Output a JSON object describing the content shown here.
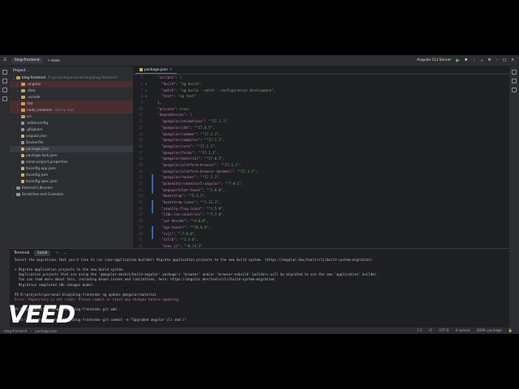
{
  "titlebar": {
    "project_chip": "blog-frontend",
    "branch": "main",
    "run_config": "Angular CLI Server"
  },
  "project_panel": {
    "title": "Project",
    "root": {
      "name": "blog-frontend",
      "path": "D:\\projects\\personal-blog\\blog-frontend"
    },
    "items": [
      {
        "label": ".angular",
        "type": "folder",
        "excluded": true,
        "expandable": true
      },
      {
        "label": ".idea",
        "type": "folder",
        "excluded": false,
        "expandable": true
      },
      {
        "label": ".vscode",
        "type": "folder",
        "excluded": false,
        "expandable": true
      },
      {
        "label": "dist",
        "type": "folder",
        "excluded": true,
        "expandable": true
      },
      {
        "label": "node_modules",
        "type": "folder",
        "excluded": true,
        "expandable": true,
        "sub": "library root"
      },
      {
        "label": "src",
        "type": "folder",
        "excluded": false,
        "expandable": true
      },
      {
        "label": ".editorconfig",
        "type": "doc",
        "excluded": false,
        "expandable": false
      },
      {
        "label": ".gitignore",
        "type": "doc",
        "excluded": false,
        "expandable": false
      },
      {
        "label": "angular.json",
        "type": "json",
        "excluded": false,
        "expandable": false
      },
      {
        "label": "Dockerfile",
        "type": "doc",
        "excluded": false,
        "expandable": false
      },
      {
        "label": "package.json",
        "type": "json",
        "excluded": false,
        "expandable": false,
        "selected": true
      },
      {
        "label": "package-lock.json",
        "type": "json",
        "excluded": false,
        "expandable": false
      },
      {
        "label": "sonar-project.properties",
        "type": "doc",
        "excluded": false,
        "expandable": false
      },
      {
        "label": "tsconfig.app.json",
        "type": "json",
        "excluded": false,
        "expandable": false
      },
      {
        "label": "tsconfig.json",
        "type": "json",
        "excluded": false,
        "expandable": false
      },
      {
        "label": "tsconfig.spec.json",
        "type": "json",
        "excluded": false,
        "expandable": false
      }
    ],
    "external_libraries": "External Libraries",
    "scratches": "Scratches and Consoles"
  },
  "editor": {
    "tab_label": "package.json",
    "lines": [
      {
        "n": "5",
        "t": "  \"scripts\": {",
        "run": false
      },
      {
        "n": "6",
        "t": "    \"build\": \"ng build\",",
        "run": true
      },
      {
        "n": "7",
        "t": "    \"watch\": \"ng build --watch --configuration development\",",
        "run": true
      },
      {
        "n": "8",
        "t": "    \"test\": \"ng test\"",
        "run": true
      },
      {
        "n": "9",
        "t": "  },",
        "run": false
      },
      {
        "n": "10",
        "t": "  \"private\": true,",
        "run": false
      },
      {
        "n": "11",
        "t": "  \"dependencies\": {",
        "run": false
      },
      {
        "n": "12",
        "t": "    \"@angular/animations\": \"^17.1.1\",",
        "run": false
      },
      {
        "n": "13",
        "t": "    \"@angular/cdk\": \"^17.0.5\",",
        "run": false
      },
      {
        "n": "14",
        "t": "    \"@angular/common\": \"^17.1.1\",",
        "run": false
      },
      {
        "n": "15",
        "t": "    \"@angular/compiler\": \"^17.1.1\",",
        "run": false
      },
      {
        "n": "16",
        "t": "    \"@angular/core\": \"^17.1.1\",",
        "run": false
      },
      {
        "n": "17",
        "t": "    \"@angular/forms\": \"^17.1.1\",",
        "run": false
      },
      {
        "n": "18",
        "t": "    \"@angular/material\": \"^17.0.5\",",
        "run": false
      },
      {
        "n": "19",
        "t": "    \"@angular/platform-browser\": \"^17.1.1\",",
        "run": false
      },
      {
        "n": "20",
        "t": "    \"@angular/platform-browser-dynamic\": \"^17.1.1\",",
        "run": false
      },
      {
        "n": "21",
        "t": "    \"@angular/router\": \"^17.1.1\",",
        "run": false
      },
      {
        "n": "22",
        "t": "    \"@ckeditor/ckeditor5-angular\": \"^7.0.1\",",
        "run": false
      },
      {
        "n": "23",
        "t": "    \"@ngxpert/hot-toast\": \"^2.0.0\",",
        "run": false
      },
      {
        "n": "24",
        "t": "    \"bootstrap\": \"^5.3.2\",",
        "run": false
      },
      {
        "n": "25",
        "t": "    \"bootstrap-icons\": \"^1.11.2\",",
        "run": false
      },
      {
        "n": "26",
        "t": "    \"country-flag-icons\": \"^1.5.9\",",
        "run": false
      },
      {
        "n": "27",
        "t": "    \"i18n-iso-countries\": \"^7.7.0\",",
        "run": false
      },
      {
        "n": "28",
        "t": "    \"jwt-decode\": \"^4.0.0\",",
        "run": false
      },
      {
        "n": "29",
        "t": "    \"ngx-toastr\": \"^18.0.0\",",
        "run": false
      },
      {
        "n": "30",
        "t": "    \"rxjs\": \"~7.8.0\",",
        "run": false
      },
      {
        "n": "31",
        "t": "    \"tslib\": \"^2.3.0\",",
        "run": false
      },
      {
        "n": "32",
        "t": "    \"zone.js\": \"~0.14.3\"",
        "run": false
      },
      {
        "n": "33",
        "t": "  },",
        "run": false
      },
      {
        "n": "34",
        "t": "  \"devDependencies\": {",
        "run": false
      }
    ]
  },
  "terminal": {
    "title": "Terminal",
    "tab": "Local",
    "lines": [
      {
        "t": "Select the migrations that you'd like to run (use-application-builder) Migrate application projects to the new build system. (https://angular.dev/tools/cli/build-system-migration)",
        "err": false
      },
      {
        "t": "",
        "err": false
      },
      {
        "t": "> Migrate application projects to the new build system.",
        "err": false
      },
      {
        "t": "  Application projects that are using the '@angular-devkit/build-angular' package's 'browser' and/or 'browser-esbuild' builders will be migrated to use the new 'application' builder.",
        "err": false
      },
      {
        "t": "  You can read more about this, including known issues and limitations, here: https://angular.dev/tools/cli/build-system-migration",
        "err": false
      },
      {
        "t": "  Migration completed (No changes made).",
        "err": false
      },
      {
        "t": "",
        "err": false
      },
      {
        "t": "PS D:\\projects\\personal-blog\\blog-frontend> ng update @angular/material",
        "err": false
      },
      {
        "t": "Error: Repository is not clean. Please commit or stash any changes before updating.",
        "err": true
      },
      {
        "t": "",
        "err": false
      },
      {
        "t": "PS D:\\projects\\personal-blog\\blog-frontend> git add .",
        "err": false
      },
      {
        "t": "",
        "err": false
      },
      {
        "t": "PS D:\\projects\\personal-blog\\blog-frontend> git commit -m \"Upgraded angular cli and c\"",
        "err": false
      }
    ]
  },
  "statusbar": {
    "path_root": "blog-frontend",
    "path_file": "package.json",
    "position": "1:1",
    "line_sep": "LF",
    "encoding": "UTF-8",
    "indent": "2 spaces",
    "schema": "JSON: package"
  },
  "watermark": "VEED"
}
